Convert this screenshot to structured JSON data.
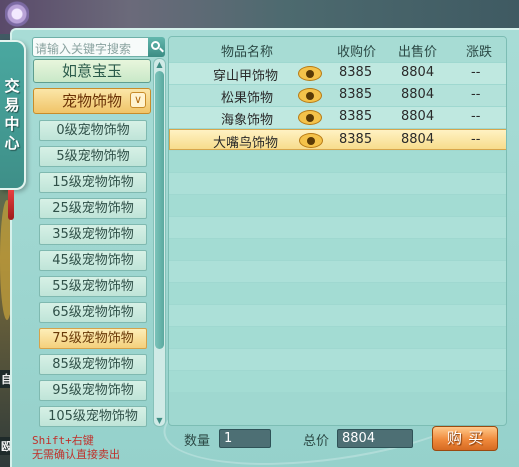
{
  "window": {
    "title_chars": [
      "交",
      "易",
      "中",
      "心"
    ]
  },
  "search": {
    "placeholder": "请输入关键字搜索"
  },
  "categories": {
    "top": "如意宝玉",
    "open": "宠物饰物",
    "open_chevron": "∨",
    "sub_items": [
      {
        "label": "0级宠物饰物",
        "active": false
      },
      {
        "label": "5级宠物饰物",
        "active": false
      },
      {
        "label": "15级宠物饰物",
        "active": false
      },
      {
        "label": "25级宠物饰物",
        "active": false
      },
      {
        "label": "35级宠物饰物",
        "active": false
      },
      {
        "label": "45级宠物饰物",
        "active": false
      },
      {
        "label": "55级宠物饰物",
        "active": false
      },
      {
        "label": "65级宠物饰物",
        "active": false
      },
      {
        "label": "75级宠物饰物",
        "active": true
      },
      {
        "label": "85级宠物饰物",
        "active": false
      },
      {
        "label": "95级宠物饰物",
        "active": false
      },
      {
        "label": "105级宠物饰物",
        "active": false
      }
    ]
  },
  "table": {
    "headers": {
      "name": "物品名称",
      "buy": "收购价",
      "sell": "出售价",
      "change": "涨跌"
    },
    "rows": [
      {
        "name": "穿山甲饰物",
        "buy": "8385",
        "sell": "8804",
        "change": "--",
        "selected": false
      },
      {
        "name": "松果饰物",
        "buy": "8385",
        "sell": "8804",
        "change": "--",
        "selected": false
      },
      {
        "name": "海象饰物",
        "buy": "8385",
        "sell": "8804",
        "change": "--",
        "selected": false
      },
      {
        "name": "大嘴鸟饰物",
        "buy": "8385",
        "sell": "8804",
        "change": "--",
        "selected": true
      }
    ],
    "empty_rows": 11
  },
  "bottom": {
    "hint_line1": "Shift+右键",
    "hint_line2": "无需确认直接卖出",
    "quantity_label": "数量",
    "quantity_value": "1",
    "total_label": "总价",
    "total_value": "8804",
    "buy_label": "购买"
  },
  "hud": {
    "frag1": "自",
    "frag2": "殴"
  },
  "colors": {
    "accent_gold": "#f4d07c",
    "panel_teal": "#a8dcd6",
    "hint_red": "#c0302a",
    "buy_orange": "#f08a3c"
  }
}
